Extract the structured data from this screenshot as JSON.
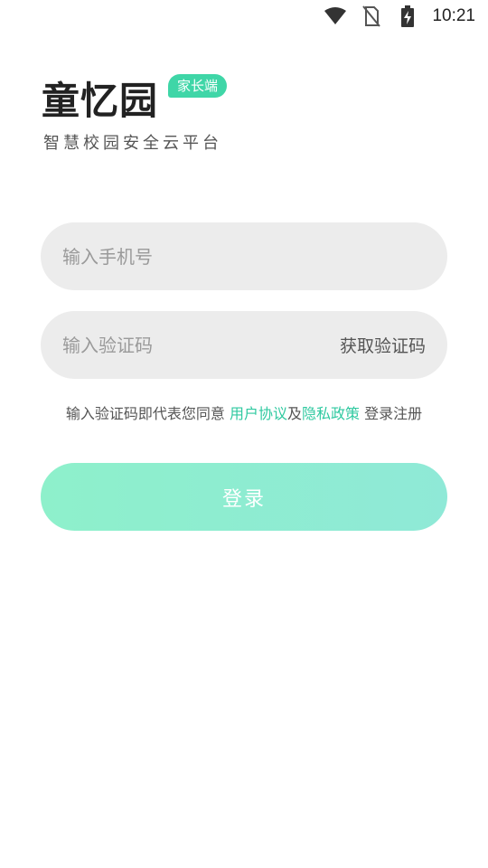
{
  "status_bar": {
    "icons": [
      "wifi-icon",
      "no-sim-icon",
      "battery-charging-icon"
    ],
    "time": "10:21"
  },
  "logo": {
    "title": "童忆园",
    "badge": "家长端",
    "slogan": "智慧校园安全云平台"
  },
  "form": {
    "phone_placeholder": "输入手机号",
    "code_placeholder": "输入验证码",
    "get_code_label": "获取验证码"
  },
  "agreement": {
    "prefix": "输入验证码即代表您同意 ",
    "user_agreement": "用户协议",
    "and": "及",
    "privacy_policy": "隐私政策",
    "suffix": " 登录注册"
  },
  "login_button": {
    "label": "登录"
  },
  "colors": {
    "accent": "#2fc9a0",
    "badge": "#3fd6a7",
    "button_start": "#8ef0cb",
    "button_end": "#8fe9d7",
    "input_bg": "#ececec"
  }
}
